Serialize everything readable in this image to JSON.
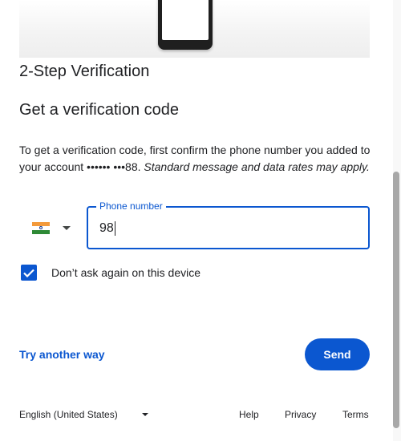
{
  "header": {
    "step_title": "2-Step Verification",
    "section_heading": "Get a verification code"
  },
  "description": {
    "text": "To get a verification code, first confirm the phone number you added to your account •••••• •••88. ",
    "italic_text": "Standard message and data rates may apply."
  },
  "country_selector": {
    "flag_icon": "india-flag-icon",
    "caret_icon": "caret-down-icon"
  },
  "phone_field": {
    "label": "Phone number",
    "value": "98"
  },
  "remember_device": {
    "checked": true,
    "label": "Don’t ask again on this device"
  },
  "actions": {
    "try_another_label": "Try another way",
    "send_label": "Send"
  },
  "footer": {
    "language": "English (United States)",
    "help": "Help",
    "privacy": "Privacy",
    "terms": "Terms"
  },
  "colors": {
    "accent": "#0b57d0",
    "text": "#202124"
  }
}
